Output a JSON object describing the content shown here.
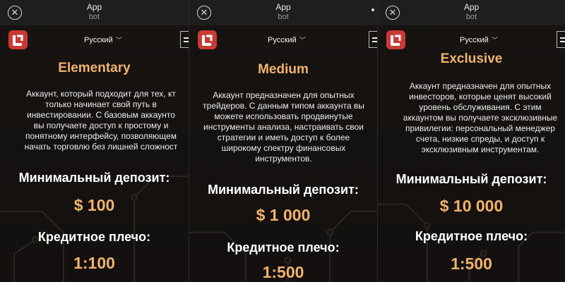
{
  "window": {
    "title": "App",
    "subtitle": "bot"
  },
  "language": "Русский",
  "tiers": [
    {
      "name": "Elementary",
      "description": [
        "Аккаунт, который подходит для тех, кт",
        "только начинает свой путь в",
        "инвестировании. С базовым аккаунто",
        "вы получаете доступ к простому и",
        "понятному интерфейсу, позволяющем",
        "начать торговлю без лишней сложност"
      ],
      "deposit_label": "Минимальный депозит:",
      "deposit_value": "$ 100",
      "leverage_label": "Кредитное плечо:",
      "leverage_value": "1:100"
    },
    {
      "name": "Medium",
      "description": [
        "Аккаунт предназначен для опытных",
        "трейдеров. С данным типом аккаунта вы",
        "можете использовать продвинутые",
        "инструменты анализа, настраивать свои",
        "стратегии и иметь доступ к более",
        "широкому спектру финансовых",
        "инструментов."
      ],
      "deposit_label": "Минимальный депозит:",
      "deposit_value": "$ 1 000",
      "leverage_label": "Кредитное плечо:",
      "leverage_value": "1:500"
    },
    {
      "name": "Exclusive",
      "description": [
        "Аккаунт предназначен для опытных",
        "инвесторов, которые ценят высокий",
        "уровень обслуживания. С этим",
        "аккаунтом вы получаете эксклюзивные",
        "привилегии: персональный менеджер",
        "счета, низкие спреды, и доступ к",
        "эксклюзивным инструментам."
      ],
      "deposit_label": "Минимальный депозит:",
      "deposit_value": "$ 10 000",
      "leverage_label": "Кредитное плечо:",
      "leverage_value": "1:500"
    }
  ],
  "icons": {
    "close": "close-icon",
    "logo": "app-logo",
    "chevron": "chevron-down-icon",
    "menu": "menu-icon"
  },
  "colors": {
    "accent": "#f1b36c",
    "logo": "#c93a35",
    "background": "#161311",
    "titlebar": "#1e1e1e"
  }
}
